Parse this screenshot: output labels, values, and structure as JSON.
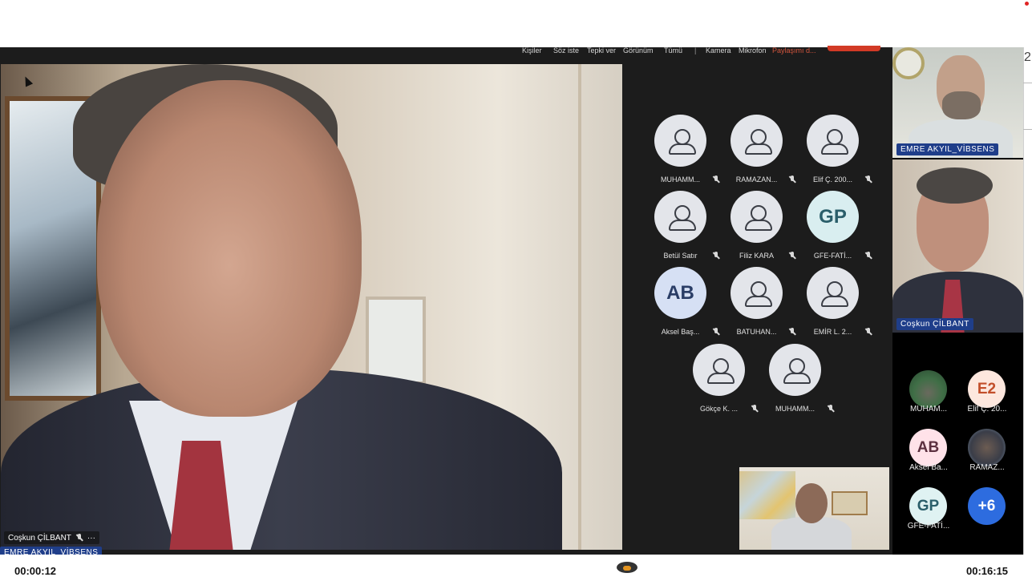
{
  "toolbar": {
    "people": "Kişiler",
    "ask": "Söz iste",
    "react": "Tepki ver",
    "view": "Görünüm",
    "all": "Tümü",
    "sep": "|",
    "camera": "Kamera",
    "mic": "Mikrofon",
    "share": "Paylaşımı d..."
  },
  "main_video": {
    "speaker_name": "Coşkun ÇİLBANT",
    "more": "···",
    "spotlight_tag": "EMRE AKYIL_VİBSENS"
  },
  "grid": [
    {
      "name": "MUHAMM...",
      "type": "avatar"
    },
    {
      "name": "RAMAZAN...",
      "type": "avatar"
    },
    {
      "name": "Elif Ç. 200...",
      "type": "avatar"
    },
    {
      "name": "Betül Satır",
      "type": "avatar"
    },
    {
      "name": "Filiz KARA",
      "type": "avatar"
    },
    {
      "name": "GFE-FATİ...",
      "type": "initials",
      "initials": "GP"
    },
    {
      "name": "Aksel Baş...",
      "type": "initials",
      "initials": "AB"
    },
    {
      "name": "BATUHAN...",
      "type": "avatar"
    },
    {
      "name": "EMİR L. 2...",
      "type": "avatar"
    },
    {
      "name": "Gökçe K. ...",
      "type": "avatar"
    },
    {
      "name": "MUHAMM...",
      "type": "avatar"
    }
  ],
  "right_panel": {
    "video1_name": "EMRE AKYIL_VİBSENS",
    "video2_name": "Coşkun ÇİLBANT",
    "minis": [
      {
        "name": "MUHAM...",
        "initials": ""
      },
      {
        "name": "Elif Ç. 20...",
        "initials": "E2"
      },
      {
        "name": "Aksel Ba...",
        "initials": "AB"
      },
      {
        "name": "RAMAZ...",
        "initials": ""
      },
      {
        "name": "GFE-FATİ...",
        "initials": "GP"
      },
      {
        "name": "",
        "initials": "+6"
      }
    ]
  },
  "edge": {
    "number": "2"
  },
  "bottom": {
    "left_time": "00:00:12",
    "right_time": "00:16:15"
  },
  "colors": {
    "end_button": "#d23a26",
    "name_tag": "#1f3e8a",
    "more_badge": "#2d6cdf"
  }
}
